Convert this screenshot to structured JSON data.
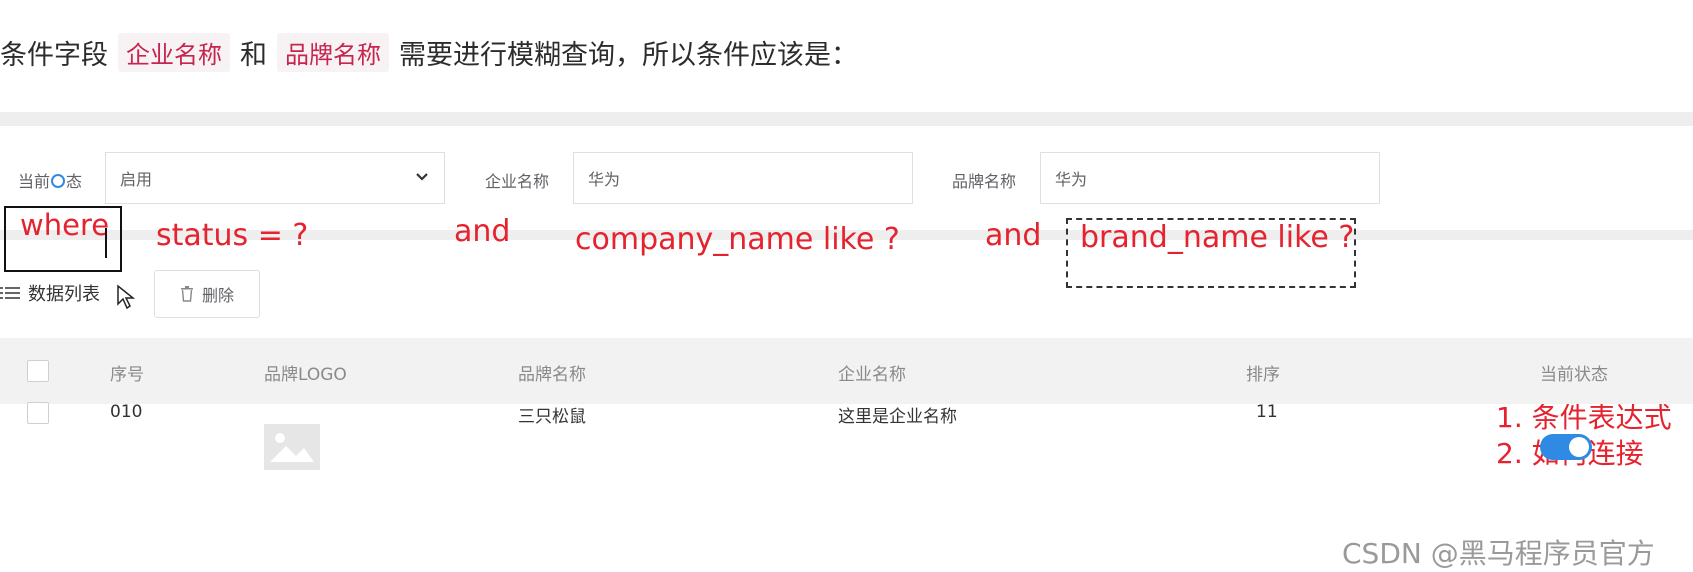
{
  "intro": {
    "before": "条件字段",
    "tag1": "企业名称",
    "middle": "和",
    "tag2": "品牌名称",
    "after": "需要进行模糊查询，所以条件应该是："
  },
  "search": {
    "status_label_before": "当前",
    "status_label_after": "态",
    "status_value": "启用",
    "company_label": "企业名称",
    "company_value": "华为",
    "brand_label": "品牌名称",
    "brand_value": "华为"
  },
  "annotations": {
    "where": "where",
    "status_cond": "status = ?",
    "and1": "and",
    "company_cond": "company_name like ?",
    "and2": "and",
    "brand_cond": "brand_name like ?",
    "note1": "1. 条件表达式",
    "note2": "2. 如何连接"
  },
  "toolbar": {
    "list_title": "数据列表",
    "delete_label": "删除"
  },
  "table": {
    "headers": [
      "序号",
      "品牌LOGO",
      "品牌名称",
      "企业名称",
      "排序",
      "当前状态"
    ],
    "rows": [
      {
        "index": "010",
        "brand_name": "三只松鼠",
        "company_name": "这里是企业名称",
        "sort": "11",
        "status_on": true
      }
    ]
  },
  "watermark": "CSDN @黑马程序员官方",
  "colors": {
    "annotation_red": "#e5232f",
    "accent_blue": "#2f8ae4"
  }
}
